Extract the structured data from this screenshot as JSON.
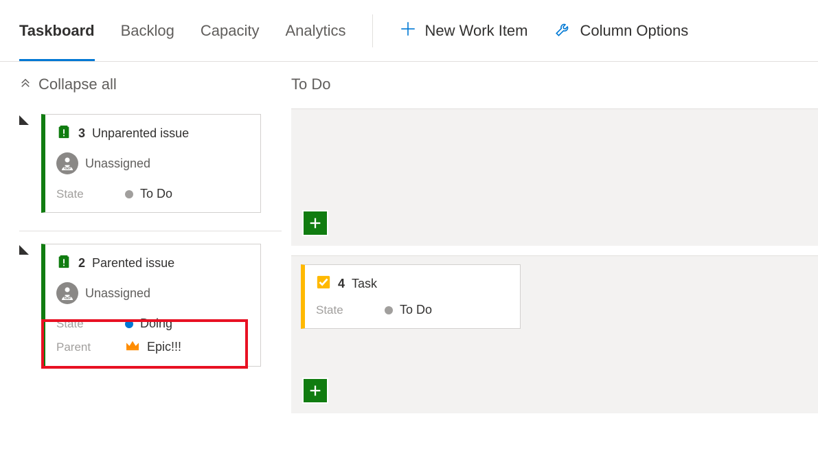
{
  "toolbar": {
    "tabs": [
      "Taskboard",
      "Backlog",
      "Capacity",
      "Analytics"
    ],
    "activeTab": 0,
    "newWorkItem": "New Work Item",
    "columnOptions": "Column Options"
  },
  "collapseAll": "Collapse all",
  "columnHeader": "To Do",
  "lanes": [
    {
      "id": "3",
      "title": "Unparented issue",
      "assignee": "Unassigned",
      "stateLabel": "State",
      "state": "To Do",
      "stateColor": "grey",
      "tasks": []
    },
    {
      "id": "2",
      "title": "Parented issue",
      "assignee": "Unassigned",
      "stateLabel": "State",
      "state": "Doing",
      "stateColor": "blue",
      "parentLabel": "Parent",
      "parent": "Epic!!!",
      "tasks": [
        {
          "id": "4",
          "title": "Task",
          "stateLabel": "State",
          "state": "To Do",
          "stateColor": "grey"
        }
      ]
    }
  ]
}
